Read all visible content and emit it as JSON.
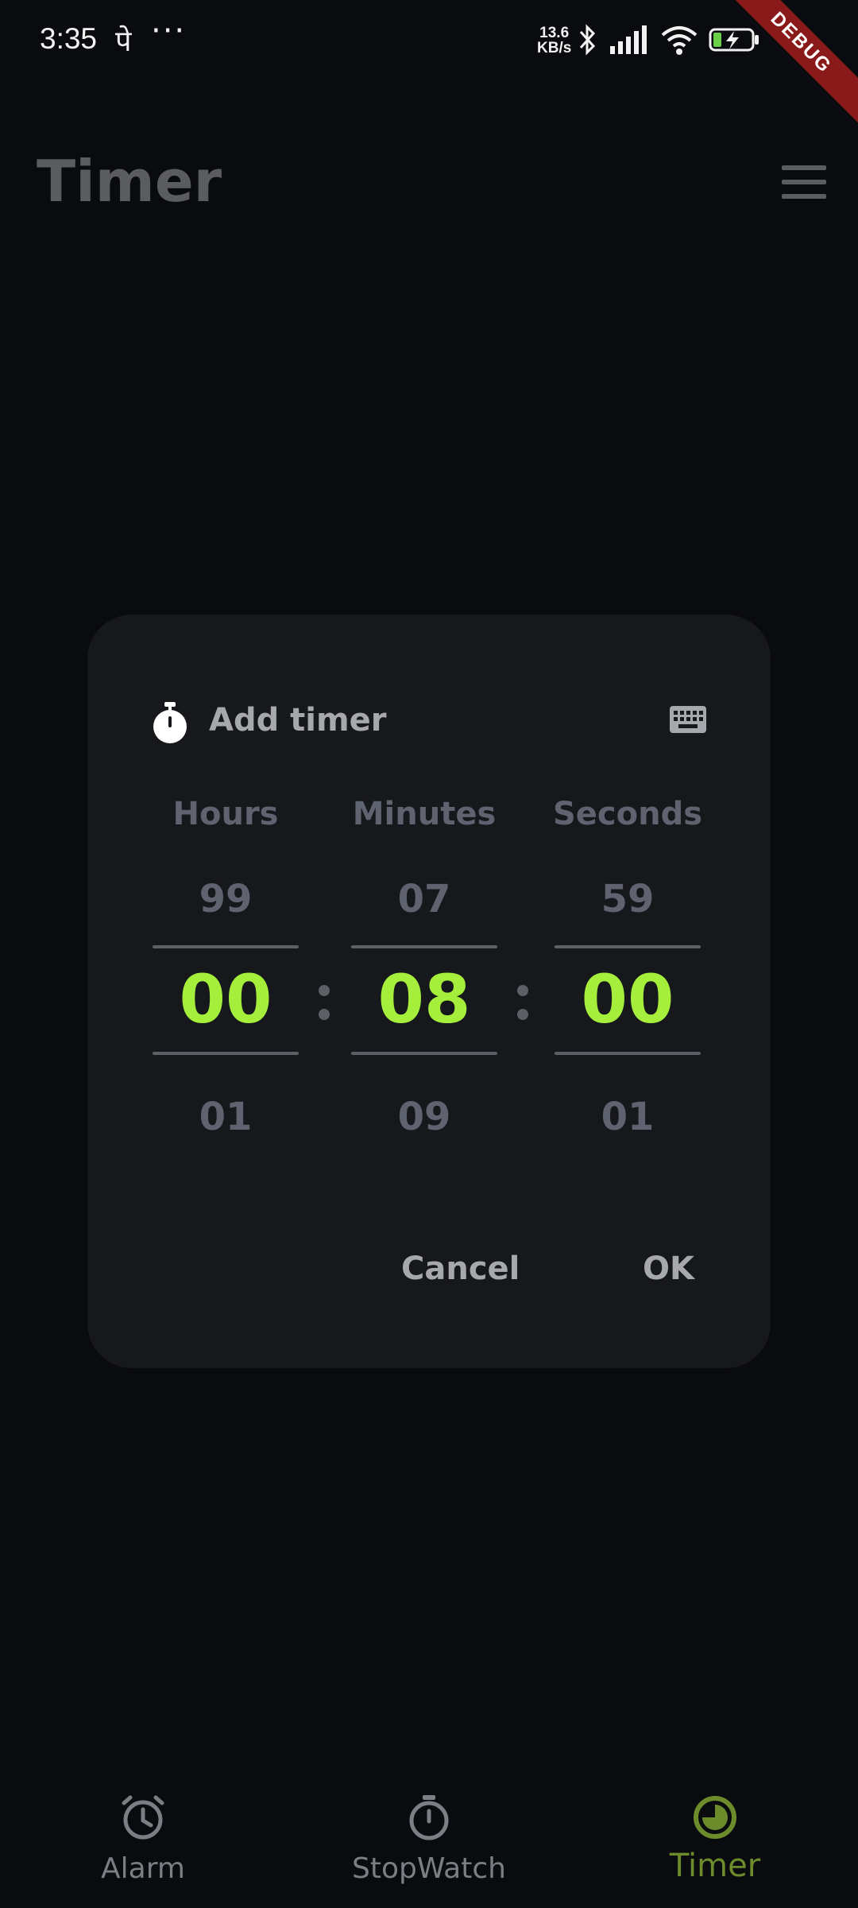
{
  "status_bar": {
    "time": "3:35",
    "notif_glyph": "पे",
    "dots": "···",
    "net_speed_value": "13.6",
    "net_speed_unit": "KB/s",
    "icons": [
      "bluetooth-icon",
      "signal-icon",
      "wifi-icon",
      "battery-charging-icon"
    ]
  },
  "debug_banner": "DEBUG",
  "app_bar": {
    "title": "Timer",
    "menu_icon": "hamburger-menu-icon"
  },
  "dialog": {
    "title": "Add timer",
    "header_icon": "stopwatch-icon",
    "keyboard_icon": "keyboard-icon",
    "columns": [
      {
        "label": "Hours",
        "prev": "99",
        "selected": "00",
        "next": "01"
      },
      {
        "label": "Minutes",
        "prev": "07",
        "selected": "08",
        "next": "09"
      },
      {
        "label": "Seconds",
        "prev": "59",
        "selected": "00",
        "next": "01"
      }
    ],
    "cancel_label": "Cancel",
    "ok_label": "OK"
  },
  "bottom_nav": {
    "items": [
      {
        "label": "Alarm",
        "icon": "alarm-clock-icon",
        "active": false
      },
      {
        "label": "StopWatch",
        "icon": "stopwatch-icon",
        "active": false
      },
      {
        "label": "Timer",
        "icon": "timer-icon",
        "active": true
      }
    ]
  },
  "colors": {
    "accent": "#a5ef3c",
    "nav_active": "#6c8c2c",
    "dialog_bg": "#17181c",
    "background": "#0a0b0e"
  }
}
